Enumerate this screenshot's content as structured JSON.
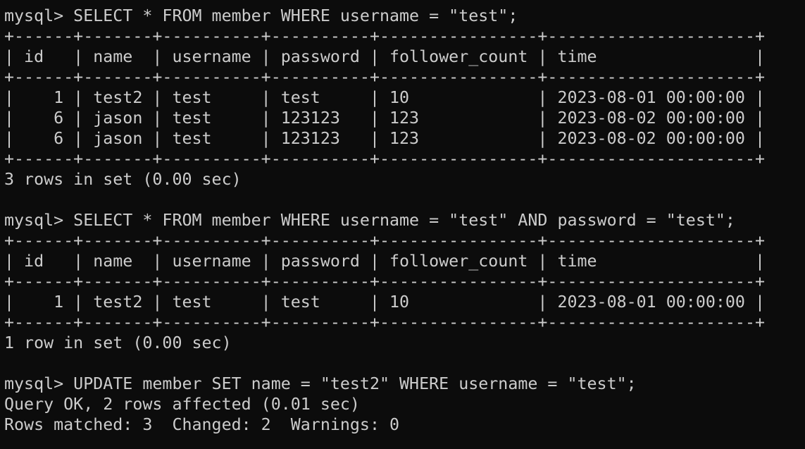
{
  "terminal": {
    "lines": [
      "mysql> SELECT * FROM member WHERE username = \"test\";",
      "+------+-------+----------+----------+----------------+---------------------+",
      "| id   | name  | username | password | follower_count | time                |",
      "+------+-------+----------+----------+----------------+---------------------+",
      "|    1 | test2 | test     | test     | 10             | 2023-08-01 00:00:00 |",
      "|    6 | jason | test     | 123123   | 123            | 2023-08-02 00:00:00 |",
      "|    6 | jason | test     | 123123   | 123            | 2023-08-02 00:00:00 |",
      "+------+-------+----------+----------+----------------+---------------------+",
      "3 rows in set (0.00 sec)",
      "",
      "mysql> SELECT * FROM member WHERE username = \"test\" AND password = \"test\";",
      "+------+-------+----------+----------+----------------+---------------------+",
      "| id   | name  | username | password | follower_count | time                |",
      "+------+-------+----------+----------+----------------+---------------------+",
      "|    1 | test2 | test     | test     | 10             | 2023-08-01 00:00:00 |",
      "+------+-------+----------+----------+----------------+---------------------+",
      "1 row in set (0.00 sec)",
      "",
      "mysql> UPDATE member SET name = \"test2\" WHERE username = \"test\";",
      "Query OK, 2 rows affected (0.01 sec)",
      "Rows matched: 3  Changed: 2  Warnings: 0"
    ]
  }
}
